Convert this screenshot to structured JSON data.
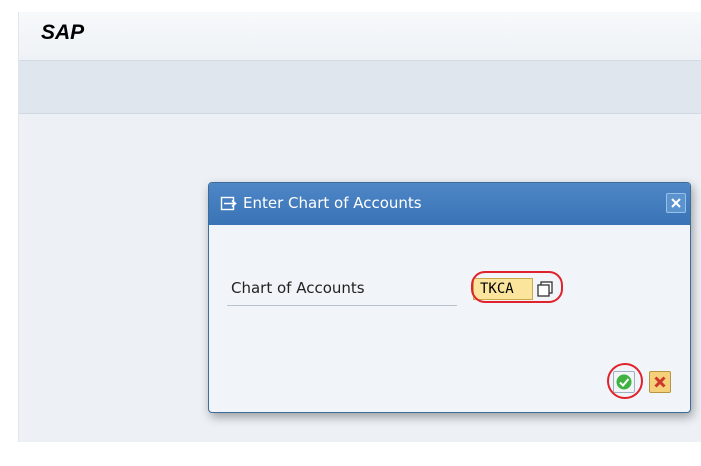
{
  "app": {
    "title": "SAP"
  },
  "dialog": {
    "title": "Enter Chart of Accounts",
    "icon": "dialog-entry-icon",
    "close_icon": "close-icon",
    "field": {
      "label": "Chart of Accounts",
      "value": "TKCA",
      "help_icon": "value-help-icon"
    },
    "buttons": {
      "ok_icon": "checkmark-icon",
      "cancel_icon": "cancel-x-icon"
    }
  },
  "colors": {
    "dialog_header": "#3a74b6",
    "input_bg": "#fbe59c",
    "highlight": "#e0222c",
    "ok_check": "#2ea42e",
    "cancel_x": "#d0382c"
  }
}
